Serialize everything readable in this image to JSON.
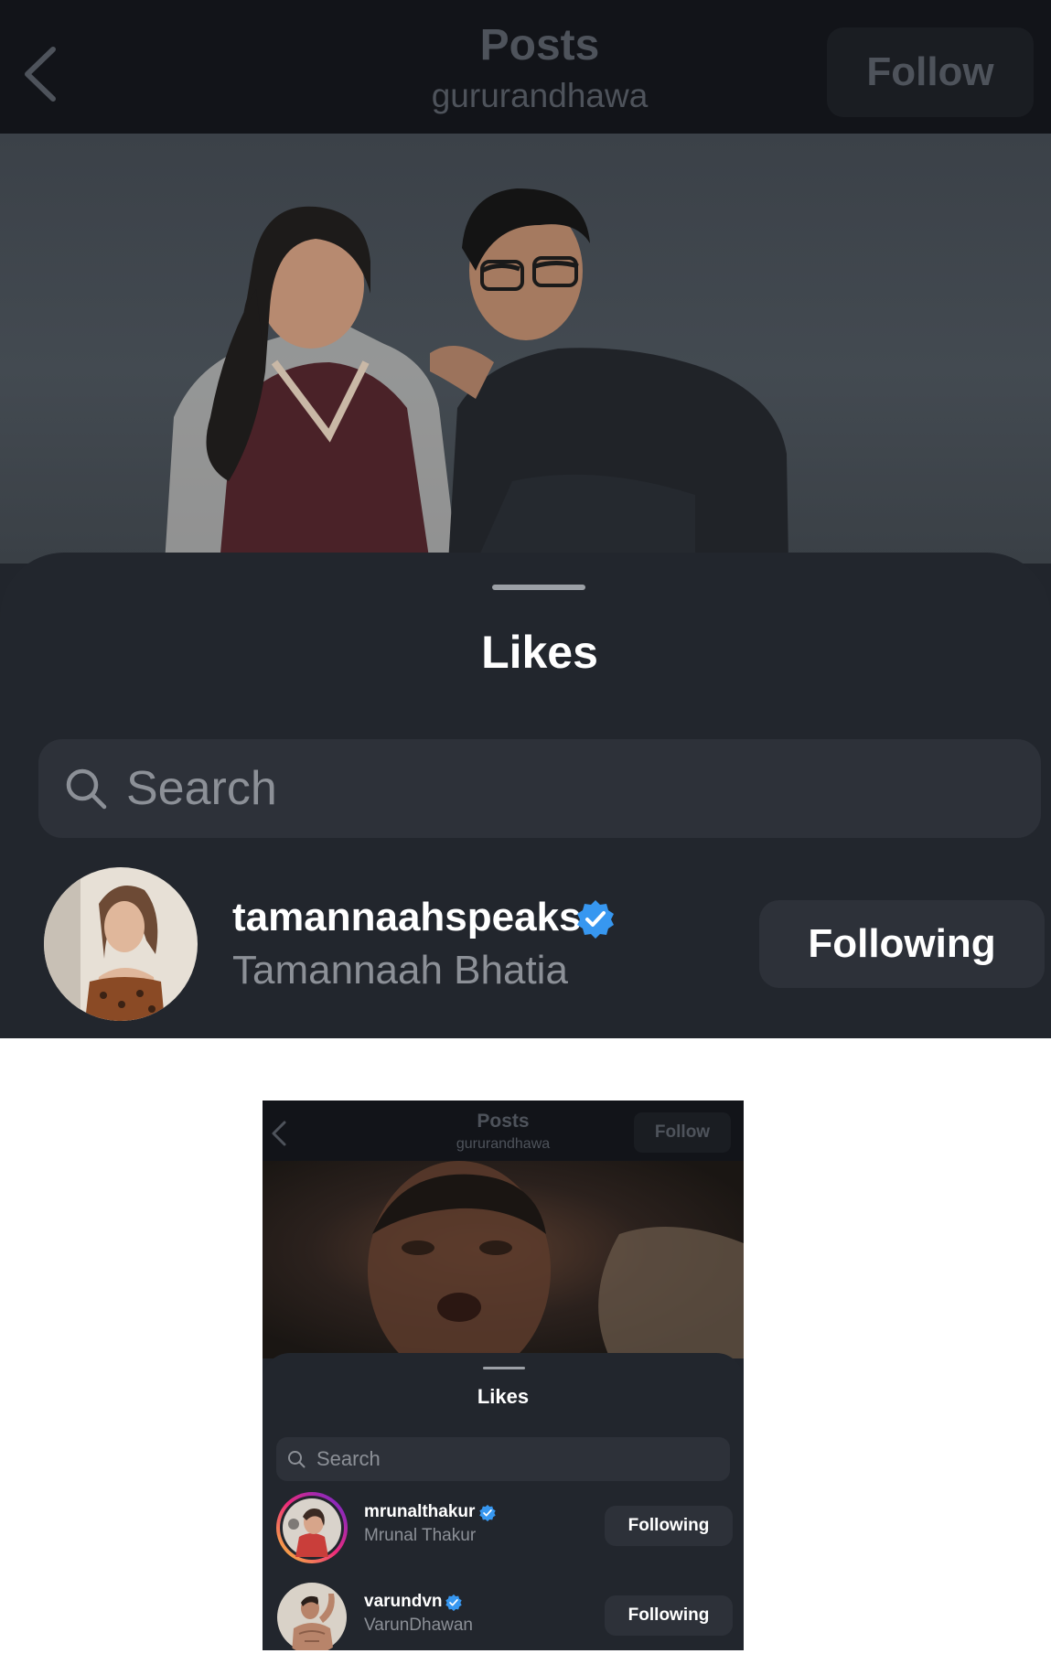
{
  "screens": [
    {
      "header": {
        "title": "Posts",
        "subtitle": "gururandhawa",
        "follow_label": "Follow"
      },
      "sheet": {
        "title": "Likes",
        "search_placeholder": "Search"
      },
      "likes": [
        {
          "username": "tamannaahspeaks",
          "full_name": "Tamannaah Bhatia",
          "verified": true,
          "button_label": "Following"
        }
      ]
    },
    {
      "header": {
        "title": "Posts",
        "subtitle": "gururandhawa",
        "follow_label": "Follow"
      },
      "sheet": {
        "title": "Likes",
        "search_placeholder": "Search"
      },
      "likes": [
        {
          "username": "mrunalthakur",
          "full_name": "Mrunal Thakur",
          "verified": true,
          "button_label": "Following"
        },
        {
          "username": "varundvn",
          "full_name": "VarunDhawan",
          "verified": true,
          "button_label": "Following"
        }
      ]
    }
  ],
  "colors": {
    "verified": "#3797f0",
    "header_bg": "#121419",
    "sheet_bg": "#22262d",
    "button_bg": "#2d3139"
  }
}
